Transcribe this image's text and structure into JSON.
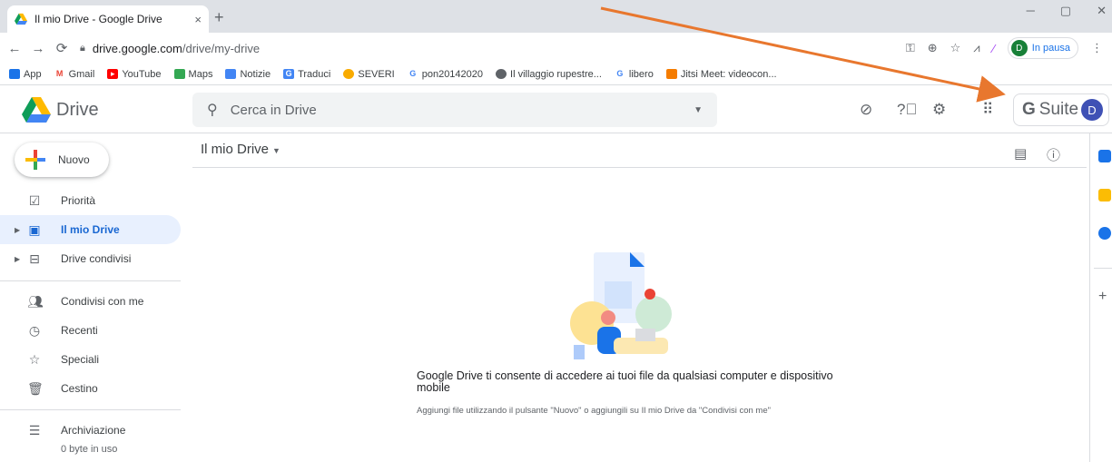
{
  "browser": {
    "tab_title": "Il mio Drive - Google Drive",
    "tab_close": "×",
    "new_tab": "+",
    "url_host": "drive.google.com",
    "url_path": "/drive/my-drive",
    "profile_initial": "D",
    "profile_status": "In pausa",
    "bookmarks": [
      "App",
      "Gmail",
      "YouTube",
      "Maps",
      "Notizie",
      "Traduci",
      "SEVERI",
      "pon20142020",
      "Il villaggio rupestre...",
      "libero",
      "Jitsi Meet: videocon..."
    ]
  },
  "header": {
    "app_name": "Drive",
    "search_placeholder": "Cerca in Drive",
    "gsuite_label": "Suite",
    "gsuite_g": "G",
    "account_initial": "D"
  },
  "sidebar": {
    "new_label": "Nuovo",
    "items": [
      {
        "label": "Priorità",
        "icon": "check-circle-icon"
      },
      {
        "label": "Il mio Drive",
        "icon": "my-drive-icon",
        "active": true
      },
      {
        "label": "Drive condivisi",
        "icon": "shared-drives-icon"
      },
      {
        "label": "Condivisi con me",
        "icon": "people-icon"
      },
      {
        "label": "Recenti",
        "icon": "clock-icon"
      },
      {
        "label": "Speciali",
        "icon": "star-icon"
      },
      {
        "label": "Cestino",
        "icon": "trash-icon"
      },
      {
        "label": "Archiviazione",
        "icon": "storage-icon"
      }
    ],
    "storage_used": "0 byte in uso"
  },
  "main": {
    "breadcrumb": "Il mio Drive",
    "empty_title": "Google Drive ti consente di accedere ai tuoi file da qualsiasi computer e dispositivo mobile",
    "empty_subtitle": "Aggiungi file utilizzando il pulsante \"Nuovo\" o aggiungili su Il mio Drive da \"Condivisi con me\""
  },
  "colors": {
    "accent": "#1967d2",
    "active_bg": "#e8f0fe",
    "annotation_arrow": "#e8772e"
  }
}
